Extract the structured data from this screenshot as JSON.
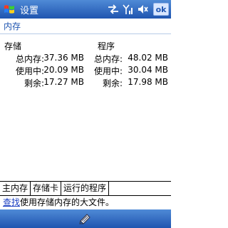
{
  "title_bar": {
    "title": "设置",
    "ok_label": "ok",
    "icons": [
      "windows-start-icon",
      "connectivity-icon",
      "signal-icon",
      "volume-icon"
    ]
  },
  "section": {
    "title": "内存"
  },
  "memory": {
    "storage_heading": "存储",
    "program_heading": "程序",
    "rows": [
      {
        "label": "总内存:",
        "storage": "37.36 MB",
        "program": "48.02 MB"
      },
      {
        "label": "使用中:",
        "storage": "20.09 MB",
        "program": "30.04 MB"
      },
      {
        "label": "剩余:",
        "storage": "17.27 MB",
        "program": "17.98 MB"
      }
    ]
  },
  "tabs": [
    {
      "label": "主内存",
      "active": true
    },
    {
      "label": "存储卡",
      "active": false
    },
    {
      "label": "运行的程序",
      "active": false
    }
  ],
  "help": {
    "link": "查找",
    "text": "使用存储内存的大文件。"
  },
  "menu_bar": {
    "icon": "keyboard-icon"
  },
  "colors": {
    "bar_top": "#4f8ad6",
    "bar_bottom": "#1f55b0",
    "accent": "#1f55b0",
    "link": "#1a3fc2"
  }
}
